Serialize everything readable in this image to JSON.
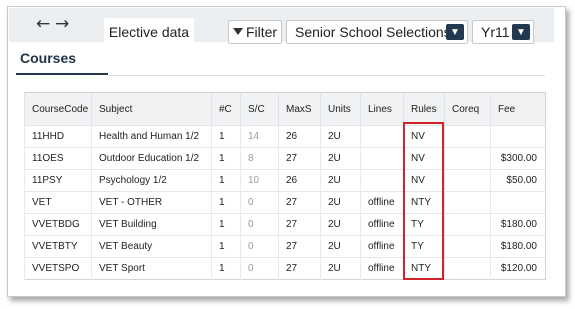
{
  "nav": {
    "back_icon": "arrow-left-icon",
    "forward_icon": "arrow-right-icon"
  },
  "tabs": {
    "elective": "Elective data"
  },
  "toolbar": {
    "filter_label": "Filter",
    "filter_icon": "filter-icon",
    "senior_select": "Senior School Selections",
    "year_select": "Yr11"
  },
  "section": {
    "courses_tab": "Courses"
  },
  "table": {
    "columns": [
      "CourseCode",
      "Subject",
      "#C",
      "S/C",
      "MaxS",
      "Units",
      "Lines",
      "Rules",
      "Coreq",
      "Fee"
    ],
    "rows": [
      [
        "11HHD",
        "Health and Human 1/2",
        "1",
        "14",
        "26",
        "2U",
        "",
        "NV",
        "",
        ""
      ],
      [
        "11OES",
        "Outdoor Education 1/2",
        "1",
        "8",
        "27",
        "2U",
        "",
        "NV",
        "",
        "$300.00"
      ],
      [
        "11PSY",
        "Psychology 1/2",
        "1",
        "10",
        "26",
        "2U",
        "",
        "NV",
        "",
        "$50.00"
      ],
      [
        "VET",
        "VET - OTHER",
        "1",
        "0",
        "27",
        "2U",
        "offline",
        "NTY",
        "",
        ""
      ],
      [
        "VVETBDG",
        "VET Building",
        "1",
        "0",
        "27",
        "2U",
        "offline",
        "TY",
        "",
        "$180.00"
      ],
      [
        "VVETBTY",
        "VET Beauty",
        "1",
        "0",
        "27",
        "2U",
        "offline",
        "TY",
        "",
        "$180.00"
      ],
      [
        "VVETSPO",
        "VET Sport",
        "1",
        "0",
        "27",
        "2U",
        "offline",
        "NTY",
        "",
        "$120.00"
      ]
    ]
  },
  "colors": {
    "accent": "#22384f",
    "highlight": "#d0232a",
    "muted": "#9a9a9a"
  }
}
